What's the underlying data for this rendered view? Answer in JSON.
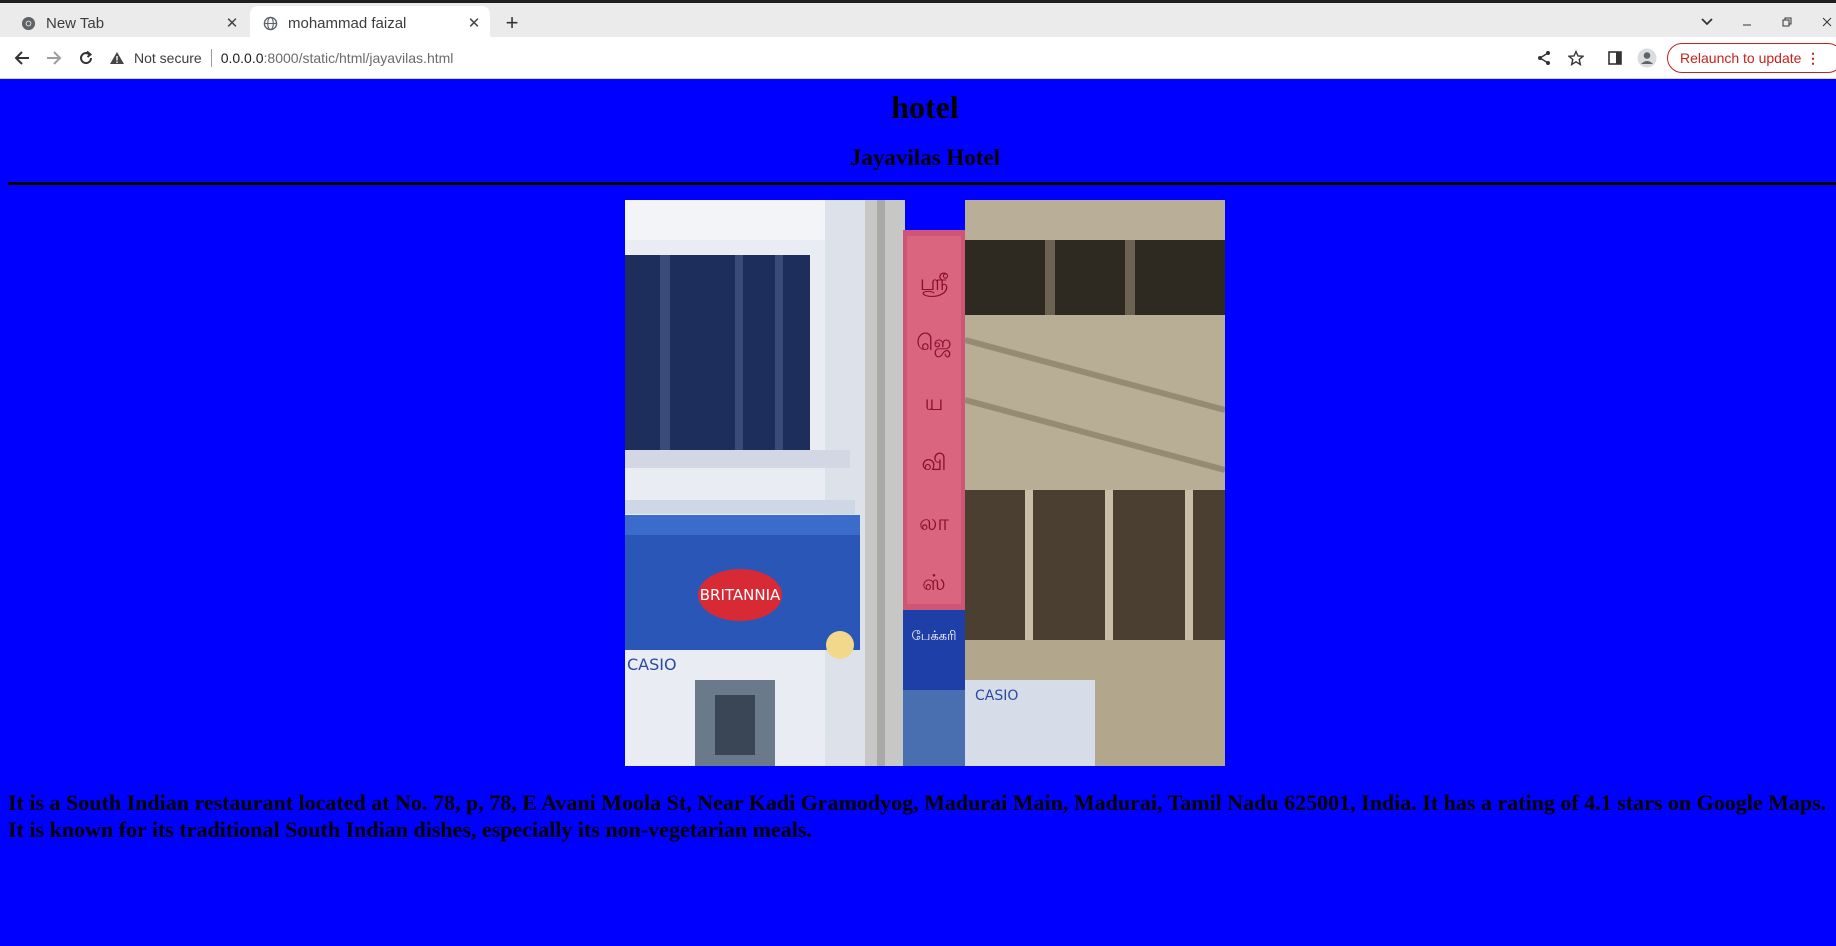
{
  "browser": {
    "tabs": [
      {
        "title": "New Tab",
        "icon": "chrome-icon",
        "active": false
      },
      {
        "title": "mohammad faizal",
        "icon": "globe-icon",
        "active": true
      }
    ],
    "address": {
      "security_label": "Not secure",
      "host": "0.0.0.0",
      "rest": ":8000/static/html/jayavilas.html"
    },
    "relaunch_label": "Relaunch to update",
    "relaunch_color": "#c5221f"
  },
  "page": {
    "background": "#0000ff",
    "heading": "hotel",
    "subheading": "Jayavilas Hotel",
    "description": "It is a South Indian restaurant located at No. 78, p, 78, E Avani Moola St, Near Kadi Gramodyog, Madurai Main, Madurai, Tamil Nadu 625001, India. It has a rating of 4.1 stars on Google Maps. It is known for its traditional South Indian dishes, especially its non-vegetarian meals.",
    "photo": {
      "sign_top": "ஸ்ரீ ஜெய விலாஸ்",
      "sign_mid": "பேக்கரி",
      "banner_brand": "BRITANNIA",
      "casio_left": "CASIO",
      "casio_right": "CASIO"
    }
  }
}
